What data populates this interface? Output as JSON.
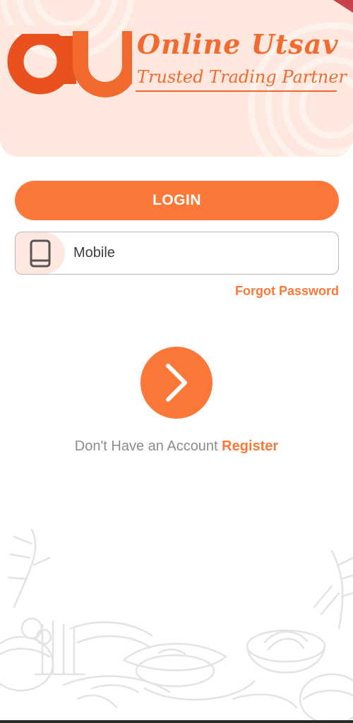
{
  "brand": {
    "name": "Online Utsav",
    "tagline": "Trusted Trading Partner",
    "logo_icon": "ou-monogram-logo"
  },
  "login": {
    "button_label": "LOGIN"
  },
  "mobile_field": {
    "placeholder": "Mobile",
    "value": "",
    "icon": "mobile-phone-icon"
  },
  "forgot_password": {
    "label": "Forgot Password"
  },
  "next_button": {
    "icon": "chevron-right-icon"
  },
  "register": {
    "prompt": "Don't Have an Account ",
    "link_label": "Register"
  },
  "colors": {
    "accent": "#fc7839",
    "brand_orange": "#f26a2e",
    "header_bg": "#fde7de",
    "muted_text": "#8c8c8c",
    "ribbon": "#c7424a"
  }
}
